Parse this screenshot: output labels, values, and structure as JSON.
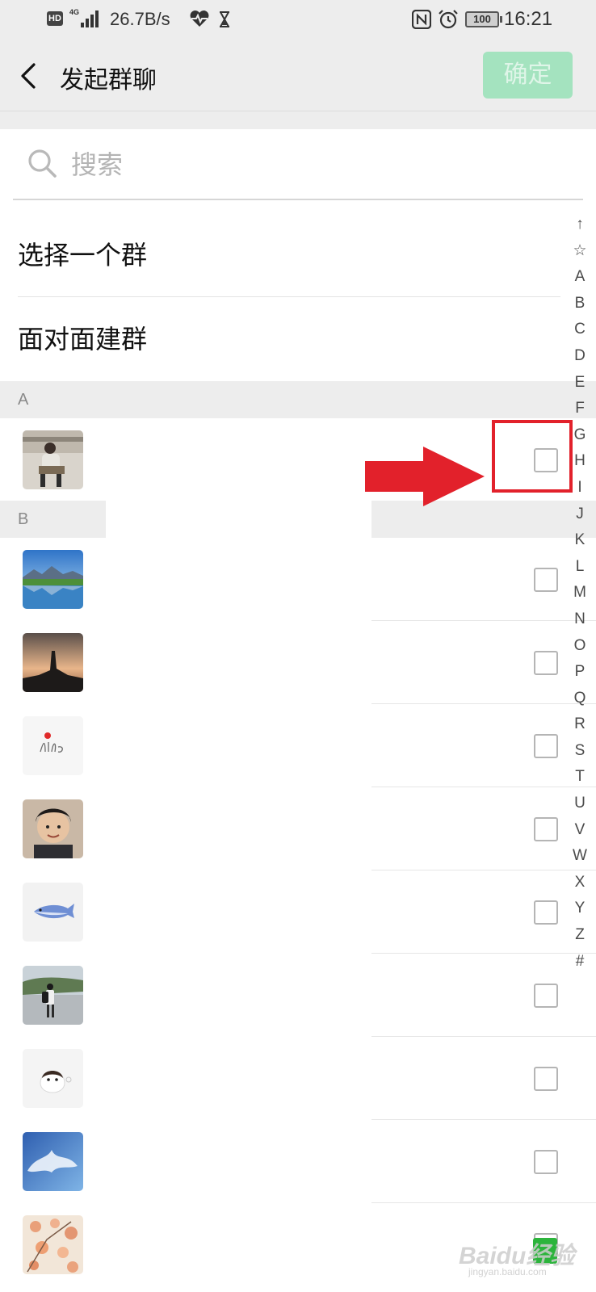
{
  "status_bar": {
    "hd_label": "HD",
    "network_label": "4G",
    "speed": "26.7B/s",
    "battery": "100",
    "time": "16:21"
  },
  "title_bar": {
    "title": "发起群聊",
    "confirm_label": "确定",
    "confirm_color": "#a4e3bf"
  },
  "search": {
    "placeholder": "搜索",
    "value": ""
  },
  "options": [
    {
      "label": "选择一个群"
    },
    {
      "label": "面对面建群"
    }
  ],
  "sections": [
    {
      "letter": "A"
    },
    {
      "letter": "B"
    }
  ],
  "contacts": [
    {
      "avatar": "person-reading-photo",
      "checked": false
    },
    {
      "avatar": "mountain-lake-photo",
      "checked": false
    },
    {
      "avatar": "sunset-silhouette-photo",
      "checked": false
    },
    {
      "avatar": "life-lettering-image",
      "checked": false
    },
    {
      "avatar": "boy-face-photo",
      "checked": false
    },
    {
      "avatar": "blue-shark-drawing",
      "checked": false
    },
    {
      "avatar": "man-walking-photo",
      "checked": false
    },
    {
      "avatar": "egg-character-drawing",
      "checked": false
    },
    {
      "avatar": "blue-sky-clouds-photo",
      "checked": false
    },
    {
      "avatar": "cherry-blossom-photo",
      "checked": false
    }
  ],
  "index_bar": [
    "↑",
    "☆",
    "A",
    "B",
    "C",
    "D",
    "E",
    "F",
    "G",
    "H",
    "I",
    "J",
    "K",
    "L",
    "M",
    "N",
    "O",
    "P",
    "Q",
    "R",
    "S",
    "T",
    "U",
    "V",
    "W",
    "X",
    "Y",
    "Z",
    "#"
  ],
  "annotation": {
    "color": "#e2212b"
  },
  "watermark": {
    "text": "Baidu经验",
    "subtext": "jingyan.baidu.com"
  }
}
